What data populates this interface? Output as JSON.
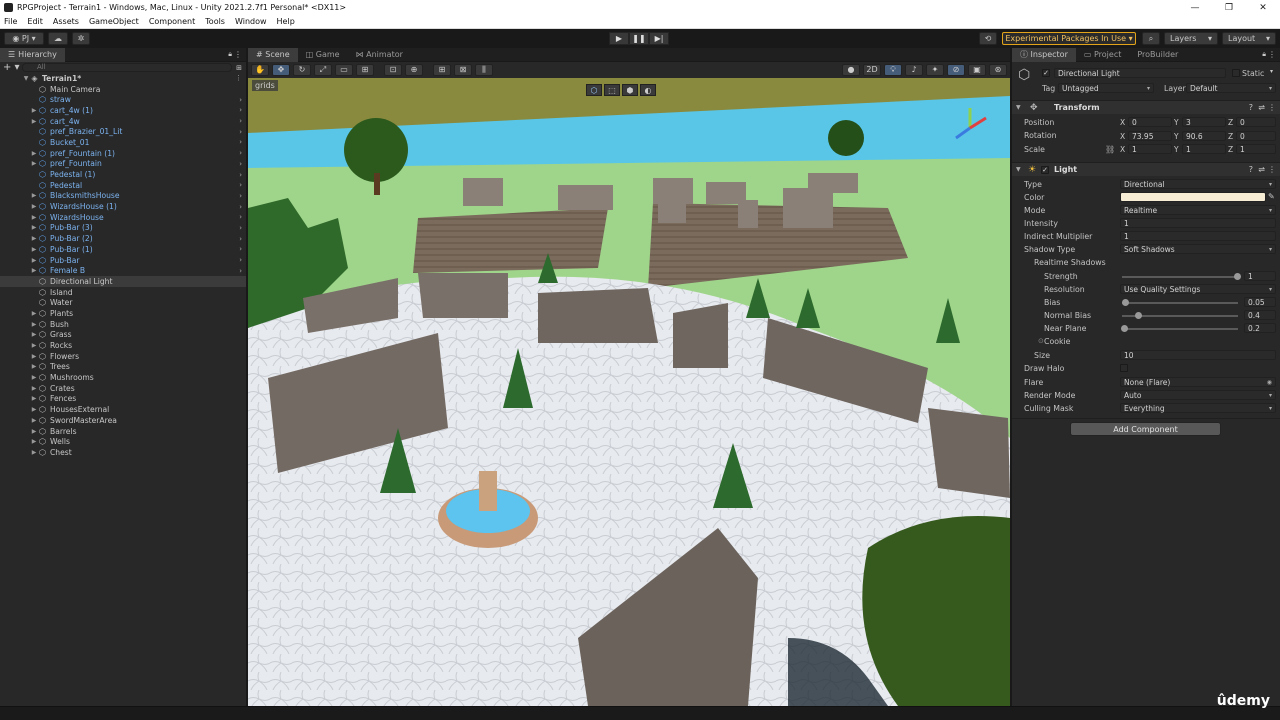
{
  "window": {
    "title": "RPGProject - Terrain1 - Windows, Mac, Linux - Unity 2021.2.7f1 Personal* <DX11>"
  },
  "menu": [
    "File",
    "Edit",
    "Assets",
    "GameObject",
    "Component",
    "Tools",
    "Window",
    "Help"
  ],
  "toolbar": {
    "account": "PJ",
    "experimental_label": "Experimental Packages In Use",
    "layers_label": "Layers",
    "layout_label": "Layout"
  },
  "hierarchy": {
    "tab": "Hierarchy",
    "search_placeholder": "All",
    "root": "Terrain1*",
    "items": [
      {
        "label": "Main Camera",
        "type": "plain",
        "arrow": false
      },
      {
        "label": "straw",
        "type": "prefab",
        "arrow": false
      },
      {
        "label": "cart_4w (1)",
        "type": "prefab",
        "arrow": true
      },
      {
        "label": "cart_4w",
        "type": "prefab",
        "arrow": true
      },
      {
        "label": "pref_Brazier_01_Lit",
        "type": "prefab",
        "arrow": false
      },
      {
        "label": "Bucket_01",
        "type": "prefab",
        "arrow": false
      },
      {
        "label": "pref_Fountain (1)",
        "type": "prefab",
        "arrow": true
      },
      {
        "label": "pref_Fountain",
        "type": "prefab",
        "arrow": true
      },
      {
        "label": "Pedestal (1)",
        "type": "prefab",
        "arrow": false
      },
      {
        "label": "Pedestal",
        "type": "prefab",
        "arrow": false
      },
      {
        "label": "BlacksmithsHouse",
        "type": "prefab",
        "arrow": true
      },
      {
        "label": "WizardsHouse (1)",
        "type": "prefab",
        "arrow": true
      },
      {
        "label": "WizardsHouse",
        "type": "prefab",
        "arrow": true
      },
      {
        "label": "Pub-Bar (3)",
        "type": "prefab",
        "arrow": true
      },
      {
        "label": "Pub-Bar (2)",
        "type": "prefab",
        "arrow": true
      },
      {
        "label": "Pub-Bar (1)",
        "type": "prefab",
        "arrow": true
      },
      {
        "label": "Pub-Bar",
        "type": "prefab",
        "arrow": true
      },
      {
        "label": "Female B",
        "type": "prefab",
        "arrow": true
      },
      {
        "label": "Directional Light",
        "type": "plain",
        "arrow": false,
        "selected": true
      },
      {
        "label": "Island",
        "type": "plain",
        "arrow": false
      },
      {
        "label": "Water",
        "type": "plain",
        "arrow": false
      },
      {
        "label": "Plants",
        "type": "plain",
        "arrow": true
      },
      {
        "label": "Bush",
        "type": "plain",
        "arrow": true
      },
      {
        "label": "Grass",
        "type": "plain",
        "arrow": true
      },
      {
        "label": "Rocks",
        "type": "plain",
        "arrow": true
      },
      {
        "label": "Flowers",
        "type": "plain",
        "arrow": true
      },
      {
        "label": "Trees",
        "type": "plain",
        "arrow": true
      },
      {
        "label": "Mushrooms",
        "type": "plain",
        "arrow": true
      },
      {
        "label": "Crates",
        "type": "plain",
        "arrow": true
      },
      {
        "label": "Fences",
        "type": "plain",
        "arrow": true
      },
      {
        "label": "HousesExternal",
        "type": "plain",
        "arrow": true
      },
      {
        "label": "SwordMasterArea",
        "type": "plain",
        "arrow": true
      },
      {
        "label": "Barrels",
        "type": "plain",
        "arrow": true
      },
      {
        "label": "Wells",
        "type": "plain",
        "arrow": true
      },
      {
        "label": "Chest",
        "type": "plain",
        "arrow": true
      }
    ]
  },
  "scene": {
    "tabs": [
      "Scene",
      "Game",
      "Animator"
    ],
    "grids_label": "grids",
    "mode_2d": "2D"
  },
  "inspector": {
    "tabs": [
      "Inspector",
      "Project",
      "ProBuilder"
    ],
    "object_name": "Directional Light",
    "static_label": "Static",
    "tag_label": "Tag",
    "tag_value": "Untagged",
    "layer_label": "Layer",
    "layer_value": "Default",
    "transform": {
      "title": "Transform",
      "position_label": "Position",
      "rotation_label": "Rotation",
      "scale_label": "Scale",
      "position": [
        "0",
        "3",
        "0"
      ],
      "rotation": [
        "73.95",
        "90.6",
        "0"
      ],
      "scale": [
        "1",
        "1",
        "1"
      ]
    },
    "light": {
      "title": "Light",
      "type_label": "Type",
      "type_value": "Directional",
      "color_label": "Color",
      "color_value": "#f7ecd4",
      "mode_label": "Mode",
      "mode_value": "Realtime",
      "intensity_label": "Intensity",
      "intensity_value": "1",
      "indirect_label": "Indirect Multiplier",
      "indirect_value": "1",
      "shadow_type_label": "Shadow Type",
      "shadow_type_value": "Soft Shadows",
      "realtime_shadows_label": "Realtime Shadows",
      "strength_label": "Strength",
      "strength_value": "1",
      "resolution_label": "Resolution",
      "resolution_value": "Use Quality Settings",
      "bias_label": "Bias",
      "bias_value": "0.05",
      "normal_bias_label": "Normal Bias",
      "normal_bias_value": "0.4",
      "near_plane_label": "Near Plane",
      "near_plane_value": "0.2",
      "cookie_label": "Cookie",
      "size_label": "Size",
      "size_value": "10",
      "draw_halo_label": "Draw Halo",
      "flare_label": "Flare",
      "flare_value": "None (Flare)",
      "render_mode_label": "Render Mode",
      "render_mode_value": "Auto",
      "culling_mask_label": "Culling Mask",
      "culling_mask_value": "Everything"
    },
    "add_component": "Add Component"
  },
  "watermark": "ûdemy"
}
